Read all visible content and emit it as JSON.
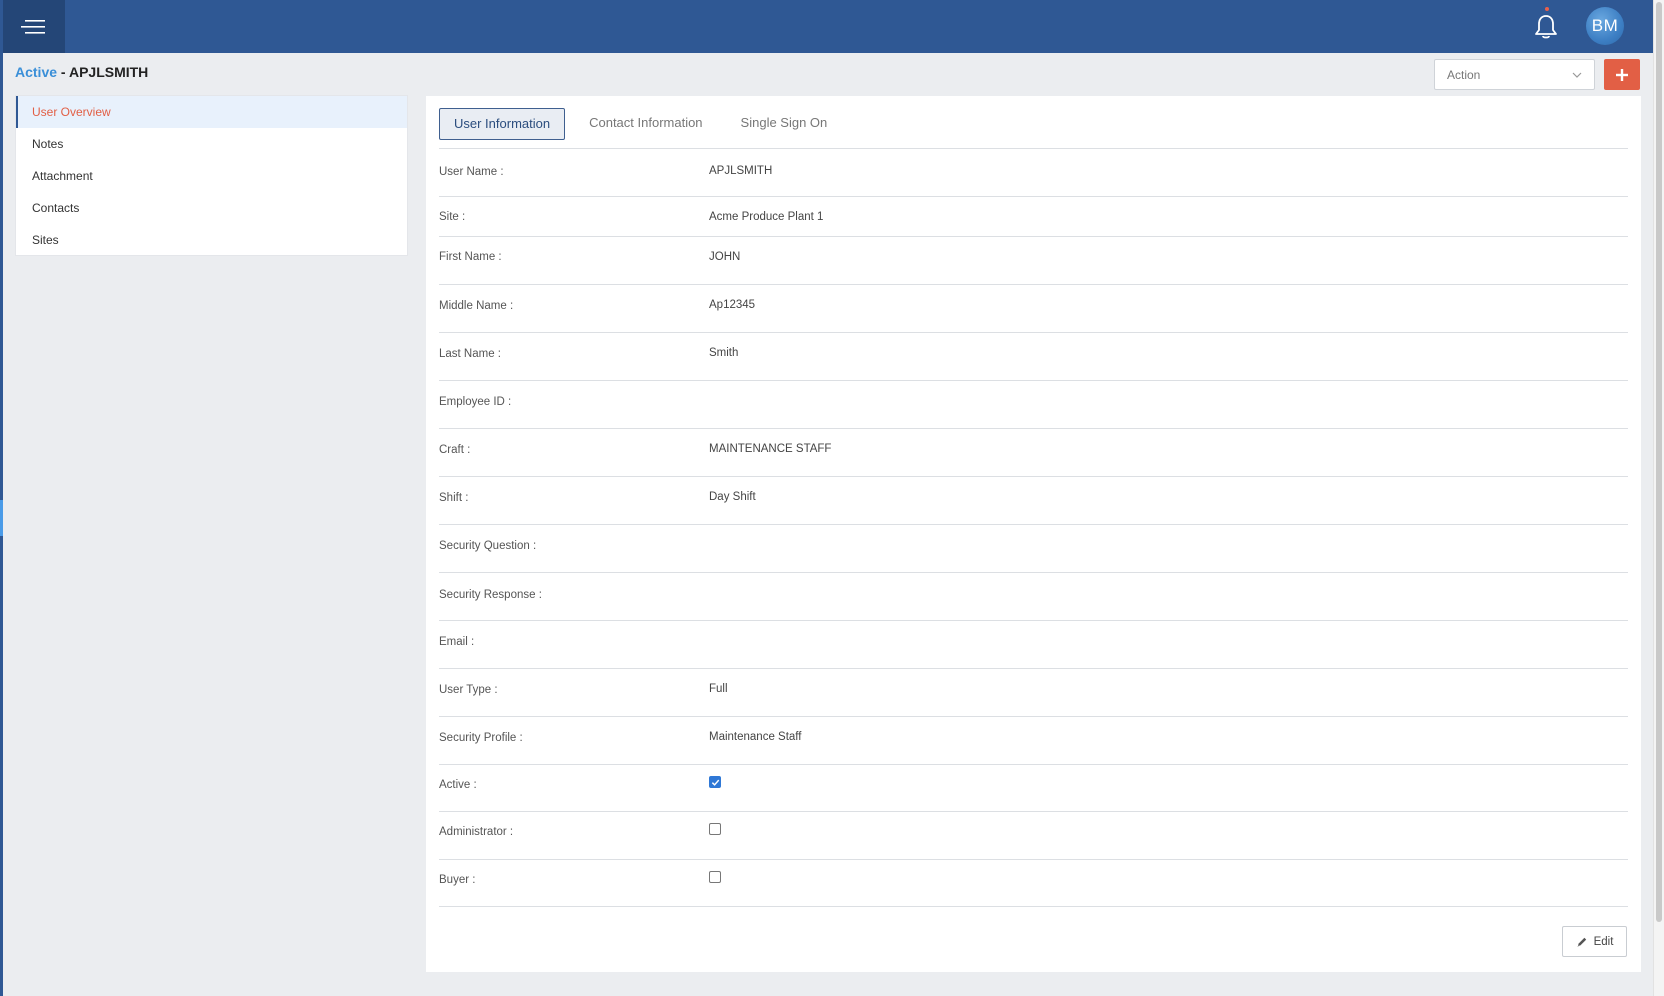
{
  "topbar": {
    "menu_icon": "hamburger-menu-icon",
    "bell_icon": "bell-icon",
    "avatar_initials": "BM"
  },
  "header": {
    "status": "Active",
    "separator": " - ",
    "username": "APJLSMITH",
    "action_select": "Action",
    "add_icon": "plus-icon"
  },
  "sidebar": {
    "items": [
      {
        "label": "User Overview",
        "active": true
      },
      {
        "label": "Notes",
        "active": false
      },
      {
        "label": "Attachment",
        "active": false
      },
      {
        "label": "Contacts",
        "active": false
      },
      {
        "label": "Sites",
        "active": false
      }
    ]
  },
  "tabs": [
    {
      "label": "User Information",
      "active": true
    },
    {
      "label": "Contact Information",
      "active": false
    },
    {
      "label": "Single Sign On",
      "active": false
    }
  ],
  "fields": [
    {
      "label": "User Name :",
      "value": "APJLSMITH"
    },
    {
      "label": "Site :",
      "value": "Acme Produce Plant 1"
    },
    {
      "label": "First Name :",
      "value": "JOHN"
    },
    {
      "label": "Middle Name :",
      "value": "Ap12345"
    },
    {
      "label": "Last Name :",
      "value": "Smith"
    },
    {
      "label": "Employee ID :",
      "value": ""
    },
    {
      "label": "Craft :",
      "value": "MAINTENANCE STAFF"
    },
    {
      "label": "Shift :",
      "value": "Day Shift"
    },
    {
      "label": "Security Question :",
      "value": ""
    },
    {
      "label": "Security Response :",
      "value": ""
    },
    {
      "label": "Email :",
      "value": ""
    },
    {
      "label": "User Type :",
      "value": "Full"
    },
    {
      "label": "Security Profile :",
      "value": "Maintenance Staff"
    },
    {
      "label": "Active :",
      "checkbox": true,
      "checked": true
    },
    {
      "label": "Administrator :",
      "checkbox": true,
      "checked": false
    },
    {
      "label": "Buyer :",
      "checkbox": true,
      "checked": false
    }
  ],
  "footer": {
    "edit_label": "Edit",
    "edit_icon": "pencil-icon"
  },
  "colors": {
    "topbar": "#2f5894",
    "accent": "#e25f45",
    "status_active": "#3a8fd8"
  }
}
